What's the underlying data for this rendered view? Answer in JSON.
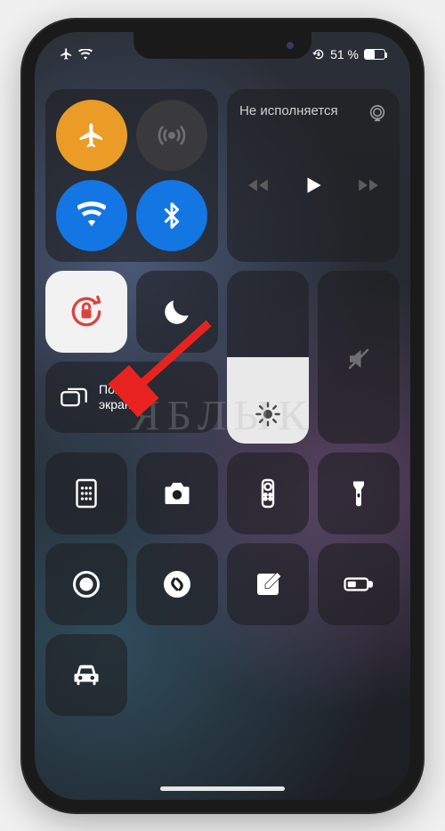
{
  "status": {
    "battery_text": "51 %",
    "battery_level": 51,
    "airplane": true,
    "wifi": true,
    "orientation_lock_indicator": true
  },
  "connectivity": {
    "airplane": {
      "active": true,
      "color": "#f39b19"
    },
    "cellular": {
      "active": false,
      "color": "#3a3a3c"
    },
    "wifi": {
      "active": true,
      "color": "#0a77f1"
    },
    "bluetooth": {
      "active": true,
      "color": "#0a77f1"
    }
  },
  "media": {
    "title": "Не исполняется"
  },
  "orientation_lock": {
    "active": true
  },
  "dnd": {
    "active": false
  },
  "screen_mirror": {
    "label": "Повтор\nэкрана"
  },
  "brightness": {
    "level": 0.5
  },
  "volume": {
    "level": 0.0,
    "muted": true
  },
  "app_tiles": [
    "calculator",
    "camera",
    "remote",
    "flashlight",
    "screen-record",
    "shazam",
    "notes",
    "low-power",
    "car"
  ],
  "watermark": "ЯБЛЫК"
}
